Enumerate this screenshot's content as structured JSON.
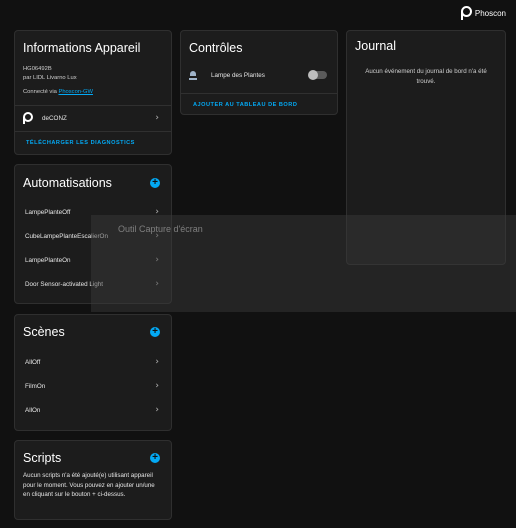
{
  "brand": {
    "name": "Phoscon"
  },
  "device_info": {
    "title": "Informations Appareil",
    "model": "HG06492B",
    "manufacturer": "par LIDL Livarno Lux",
    "connected_prefix": "Connecté via",
    "connected_link": "Phoscon-GW",
    "integration": "deCONZ",
    "action": "TÉLÉCHARGER LES DIAGNOSTICS"
  },
  "controls": {
    "title": "Contrôles",
    "entity_name": "Lampe des Plantes",
    "action": "AJOUTER AU TABLEAU DE BORD"
  },
  "journal": {
    "title": "Journal",
    "empty_message": "Aucun événement du journal de bord n'a été trouvé."
  },
  "automations": {
    "title": "Automatisations",
    "items": [
      "LampePlanteOff",
      "CubeLampePlanteEscalierOn",
      "LampePlanteOn",
      "Door Sensor-activated Light"
    ]
  },
  "scenes": {
    "title": "Scènes",
    "items": [
      "AllOff",
      "FilmOn",
      "AllOn"
    ]
  },
  "scripts": {
    "title": "Scripts",
    "empty_message": "Aucun scripts n'a été ajouté(e) utilisant appareil pour le moment. Vous pouvez en ajouter un/une en cliquant sur le bouton + ci-dessus."
  },
  "overlay": {
    "text": "Outil Capture d'écran"
  },
  "colors": {
    "accent": "#03a9f4",
    "card": "#1c1c1c",
    "background": "#111111"
  }
}
